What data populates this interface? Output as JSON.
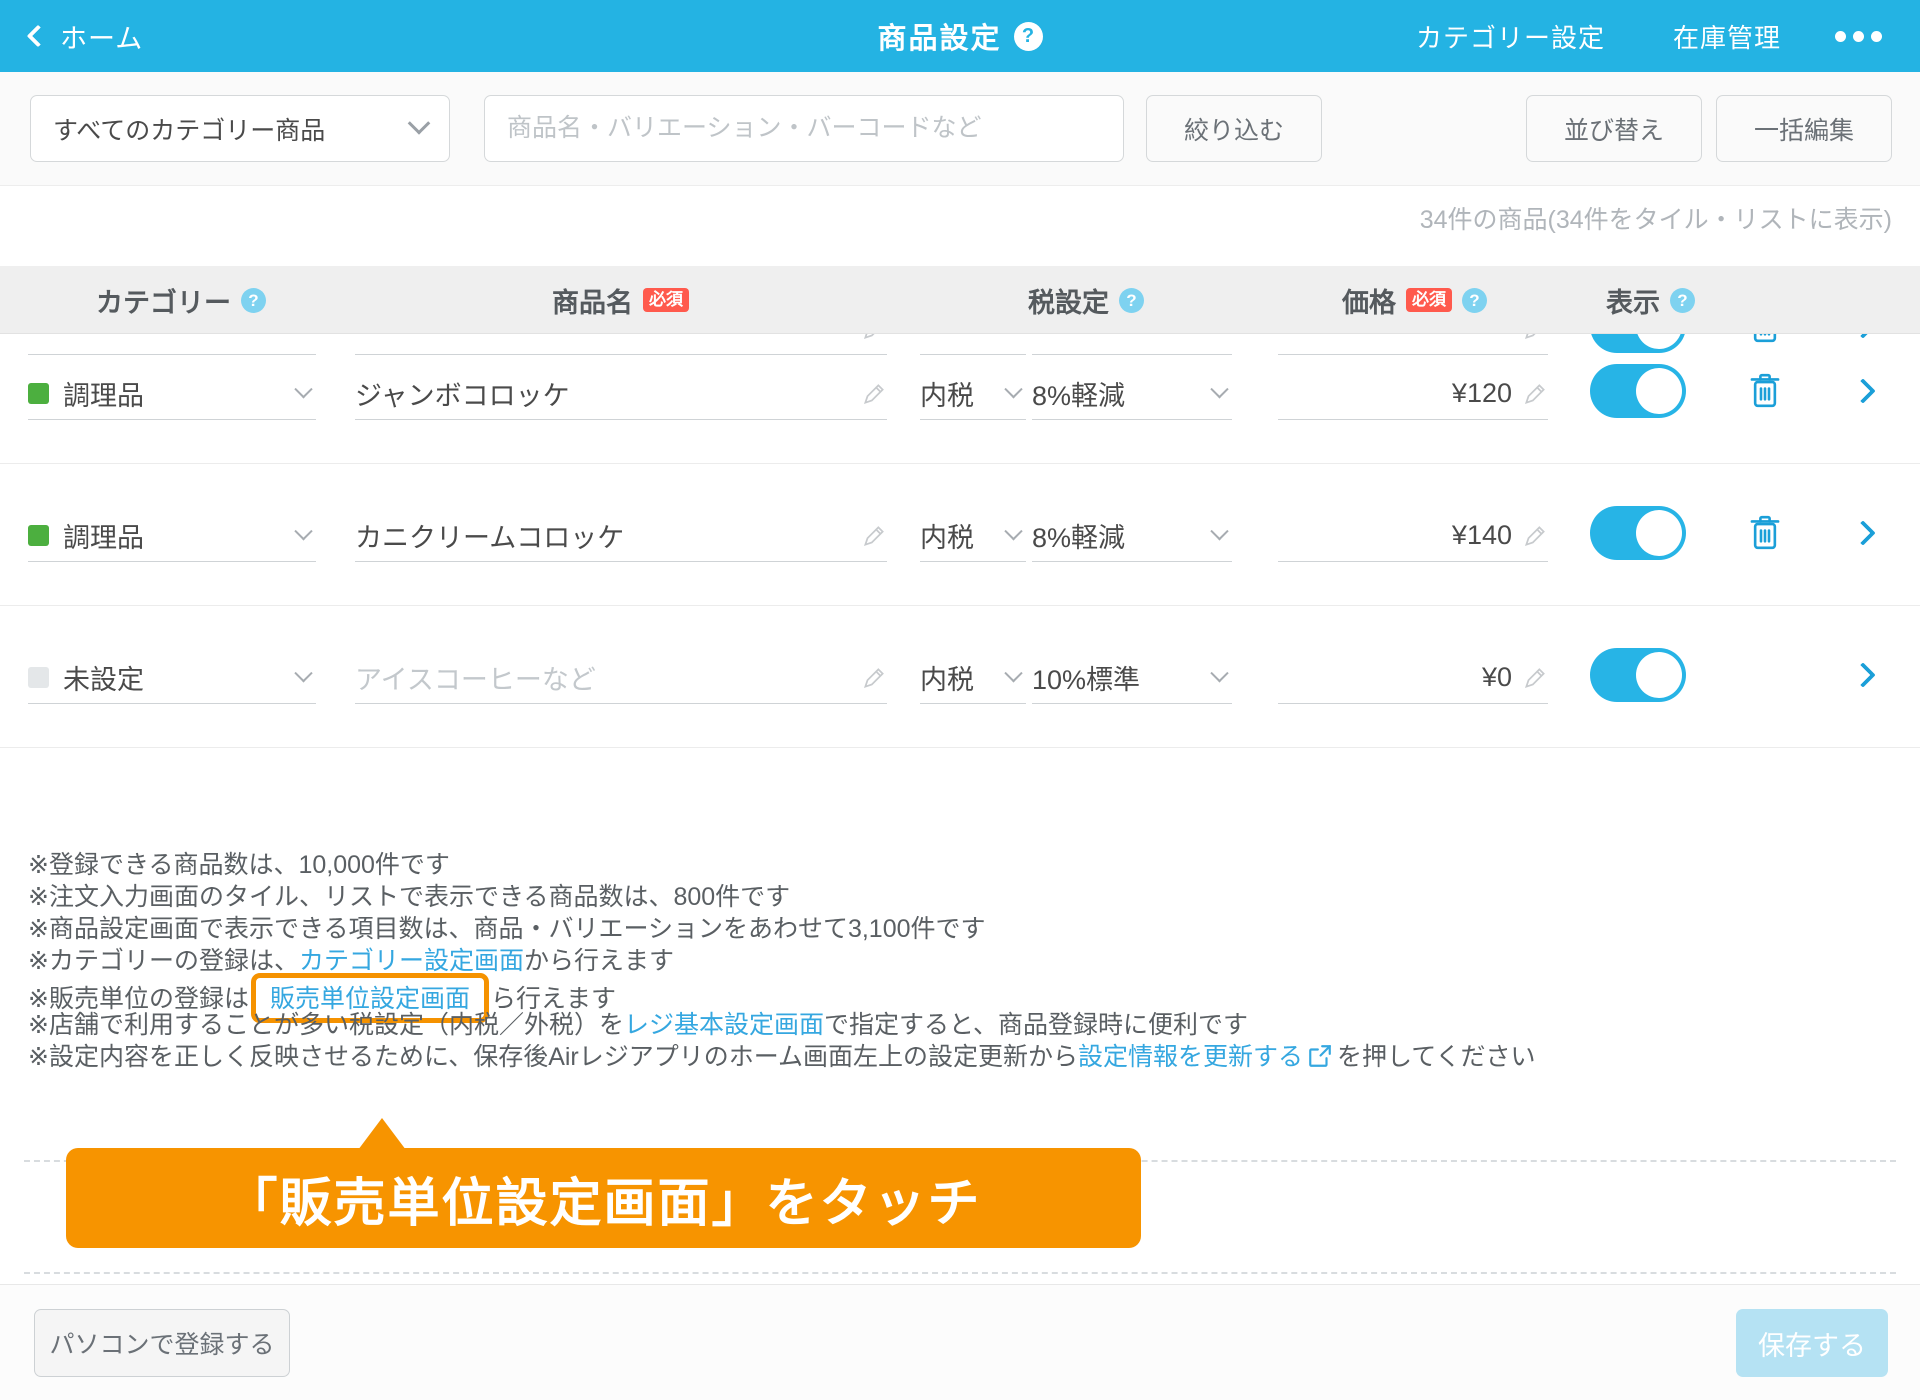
{
  "header": {
    "back_label": "ホーム",
    "back_icon": "chevron-left-icon",
    "title": "商品設定",
    "help_icon": "question-mark-icon",
    "links": [
      {
        "label": "カテゴリー設定"
      },
      {
        "label": "在庫管理"
      }
    ],
    "more_icon": "ellipsis-icon",
    "bg_color": "#24b3e3"
  },
  "toolbar": {
    "category_filter_value": "すべてのカテゴリー商品",
    "category_filter_icon": "chevron-down-icon",
    "search_placeholder": "商品名・バリエーション・バーコードなど",
    "search_value": "",
    "filter_label": "絞り込む",
    "sort_label": "並び替え",
    "bulk_edit_label": "一括編集"
  },
  "count_text": "34件の商品(34件をタイル・リストに表示)",
  "table": {
    "columns": [
      {
        "label": "カテゴリー",
        "required": false,
        "help": true
      },
      {
        "label": "商品名",
        "required_badge": "必須",
        "help": false
      },
      {
        "label": "税設定",
        "required": false,
        "help": true
      },
      {
        "label": "価格",
        "required_badge": "必須",
        "help": true
      },
      {
        "label": "表示",
        "required": false,
        "help": true
      }
    ],
    "rows": [
      {
        "clipped": true,
        "category": "",
        "category_color": "#ffffff",
        "name": "",
        "tax_type": "",
        "tax_rate": "",
        "price": "",
        "visible": true,
        "deletable": true
      },
      {
        "clipped": false,
        "category": "調理品",
        "category_color": "#4caf3f",
        "name": "ジャンボコロッケ",
        "name_is_placeholder": false,
        "tax_type": "内税",
        "tax_rate": "8%軽減",
        "price": "¥120",
        "visible": true,
        "deletable": true
      },
      {
        "clipped": false,
        "category": "調理品",
        "category_color": "#4caf3f",
        "name": "カニクリームコロッケ",
        "name_is_placeholder": false,
        "tax_type": "内税",
        "tax_rate": "8%軽減",
        "price": "¥140",
        "visible": true,
        "deletable": true
      },
      {
        "clipped": false,
        "category": "未設定",
        "category_color": "#e4e7e9",
        "name": "アイスコーヒーなど",
        "name_is_placeholder": true,
        "tax_type": "内税",
        "tax_rate": "10%標準",
        "price": "¥0",
        "visible": true,
        "deletable": false
      }
    ]
  },
  "notes": [
    {
      "text": "※登録できる商品数は、10,000件です"
    },
    {
      "text": "※注文入力画面のタイル、リストで表示できる商品数は、800件です"
    },
    {
      "text": "※商品設定画面で表示できる項目数は、商品・バリエーションをあわせて3,100件です"
    },
    {
      "prefix": "※カテゴリーの登録は、",
      "link": "カテゴリー設定画面",
      "suffix": "から行えます"
    },
    {
      "prefix": "※販売単位の登録は",
      "link": "販売単位設定画面",
      "highlight": true,
      "suffix": "ら行えます"
    },
    {
      "prefix": "※店舗で利用することが多い税設定（内税／外税）を",
      "link": "レジ基本設定画面",
      "suffix": "で指定すると、商品登録時に便利です"
    },
    {
      "prefix": "※設定内容を正しく反映させるために、保存後Airレジアプリのホーム画面左上の設定更新から",
      "link": "設定情報を更新する",
      "external_icon": true,
      "suffix": "を押してください"
    }
  ],
  "callout": {
    "text": "「販売単位設定画面」をタッチ",
    "color": "#f79400"
  },
  "footer": {
    "pc_register_label": "パソコンで登録する",
    "save_label": "保存する",
    "save_disabled": true
  },
  "colors": {
    "accent": "#24b3e3",
    "required": "#ff5a4d",
    "highlight": "#f59200",
    "link": "#35a7e0"
  }
}
